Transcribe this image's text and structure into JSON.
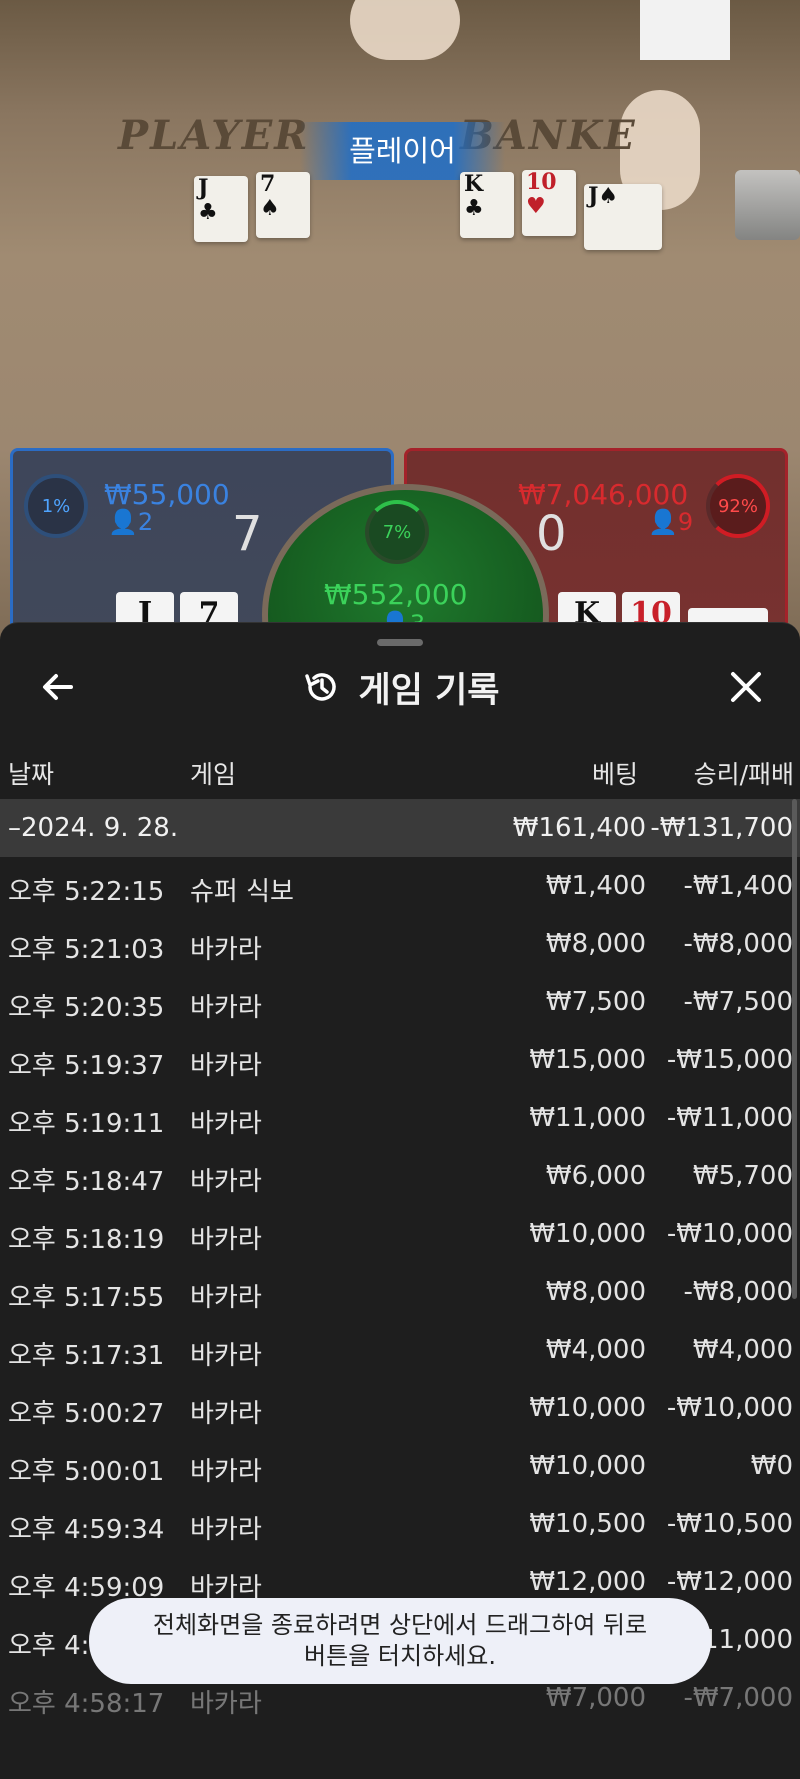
{
  "video": {
    "player_word": "PLAYER",
    "banker_word": "BANKE",
    "player_banner": "플레이어",
    "player_cards": [
      {
        "rank": "J",
        "suit": "♣",
        "color": "black"
      },
      {
        "rank": "7",
        "suit": "♠",
        "color": "black"
      }
    ],
    "banker_cards": [
      {
        "rank": "K",
        "suit": "♣",
        "color": "black"
      },
      {
        "rank": "10",
        "suit": "♥",
        "color": "red"
      },
      {
        "rank": "J",
        "suit": "♠",
        "color": "black"
      }
    ]
  },
  "betting": {
    "player": {
      "percent": "1%",
      "amount": "₩55,000",
      "people": "2",
      "score": "7",
      "cards": [
        "J",
        "7"
      ]
    },
    "tie": {
      "percent": "7%",
      "amount": "₩552,000",
      "people": "3"
    },
    "banker": {
      "percent": "92%",
      "amount": "₩7,046,000",
      "people": "9",
      "score": "0",
      "cards": [
        "K",
        "10"
      ]
    }
  },
  "sheet": {
    "title": "게임 기록",
    "icons": {
      "back": "arrow-left-icon",
      "title": "history-icon",
      "close": "close-icon"
    },
    "columns": {
      "date": "날짜",
      "game": "게임",
      "bet": "베팅",
      "win_loss": "승리/패배"
    },
    "date_group": {
      "date": "–2024. 9. 28.",
      "bet": "₩161,400",
      "win_loss": "-₩131,700"
    },
    "rows": [
      {
        "time": "오후 5:22:15",
        "game": "슈퍼 식보",
        "bet": "₩1,400",
        "result": "-₩1,400"
      },
      {
        "time": "오후 5:21:03",
        "game": "바카라",
        "bet": "₩8,000",
        "result": "-₩8,000"
      },
      {
        "time": "오후 5:20:35",
        "game": "바카라",
        "bet": "₩7,500",
        "result": "-₩7,500"
      },
      {
        "time": "오후 5:19:37",
        "game": "바카라",
        "bet": "₩15,000",
        "result": "-₩15,000"
      },
      {
        "time": "오후 5:19:11",
        "game": "바카라",
        "bet": "₩11,000",
        "result": "-₩11,000"
      },
      {
        "time": "오후 5:18:47",
        "game": "바카라",
        "bet": "₩6,000",
        "result": "₩5,700"
      },
      {
        "time": "오후 5:18:19",
        "game": "바카라",
        "bet": "₩10,000",
        "result": "-₩10,000"
      },
      {
        "time": "오후 5:17:55",
        "game": "바카라",
        "bet": "₩8,000",
        "result": "-₩8,000"
      },
      {
        "time": "오후 5:17:31",
        "game": "바카라",
        "bet": "₩4,000",
        "result": "₩4,000"
      },
      {
        "time": "오후 5:00:27",
        "game": "바카라",
        "bet": "₩10,000",
        "result": "-₩10,000"
      },
      {
        "time": "오후 5:00:01",
        "game": "바카라",
        "bet": "₩10,000",
        "result": "₩0"
      },
      {
        "time": "오후 4:59:34",
        "game": "바카라",
        "bet": "₩10,500",
        "result": "-₩10,500"
      },
      {
        "time": "오후 4:59:09",
        "game": "바카라",
        "bet": "₩12,000",
        "result": "-₩12,000"
      },
      {
        "time": "오후 4:",
        "game": "",
        "bet": "",
        "result": "11,000"
      },
      {
        "time": "오후 4:58:17",
        "game": "바카라",
        "bet": "₩7,000",
        "result": "-₩7,000"
      }
    ],
    "toast": {
      "line1": "전체화면을 종료하려면 상단에서 드래그하여 뒤로",
      "line2": "버튼을 터치하세요."
    }
  }
}
